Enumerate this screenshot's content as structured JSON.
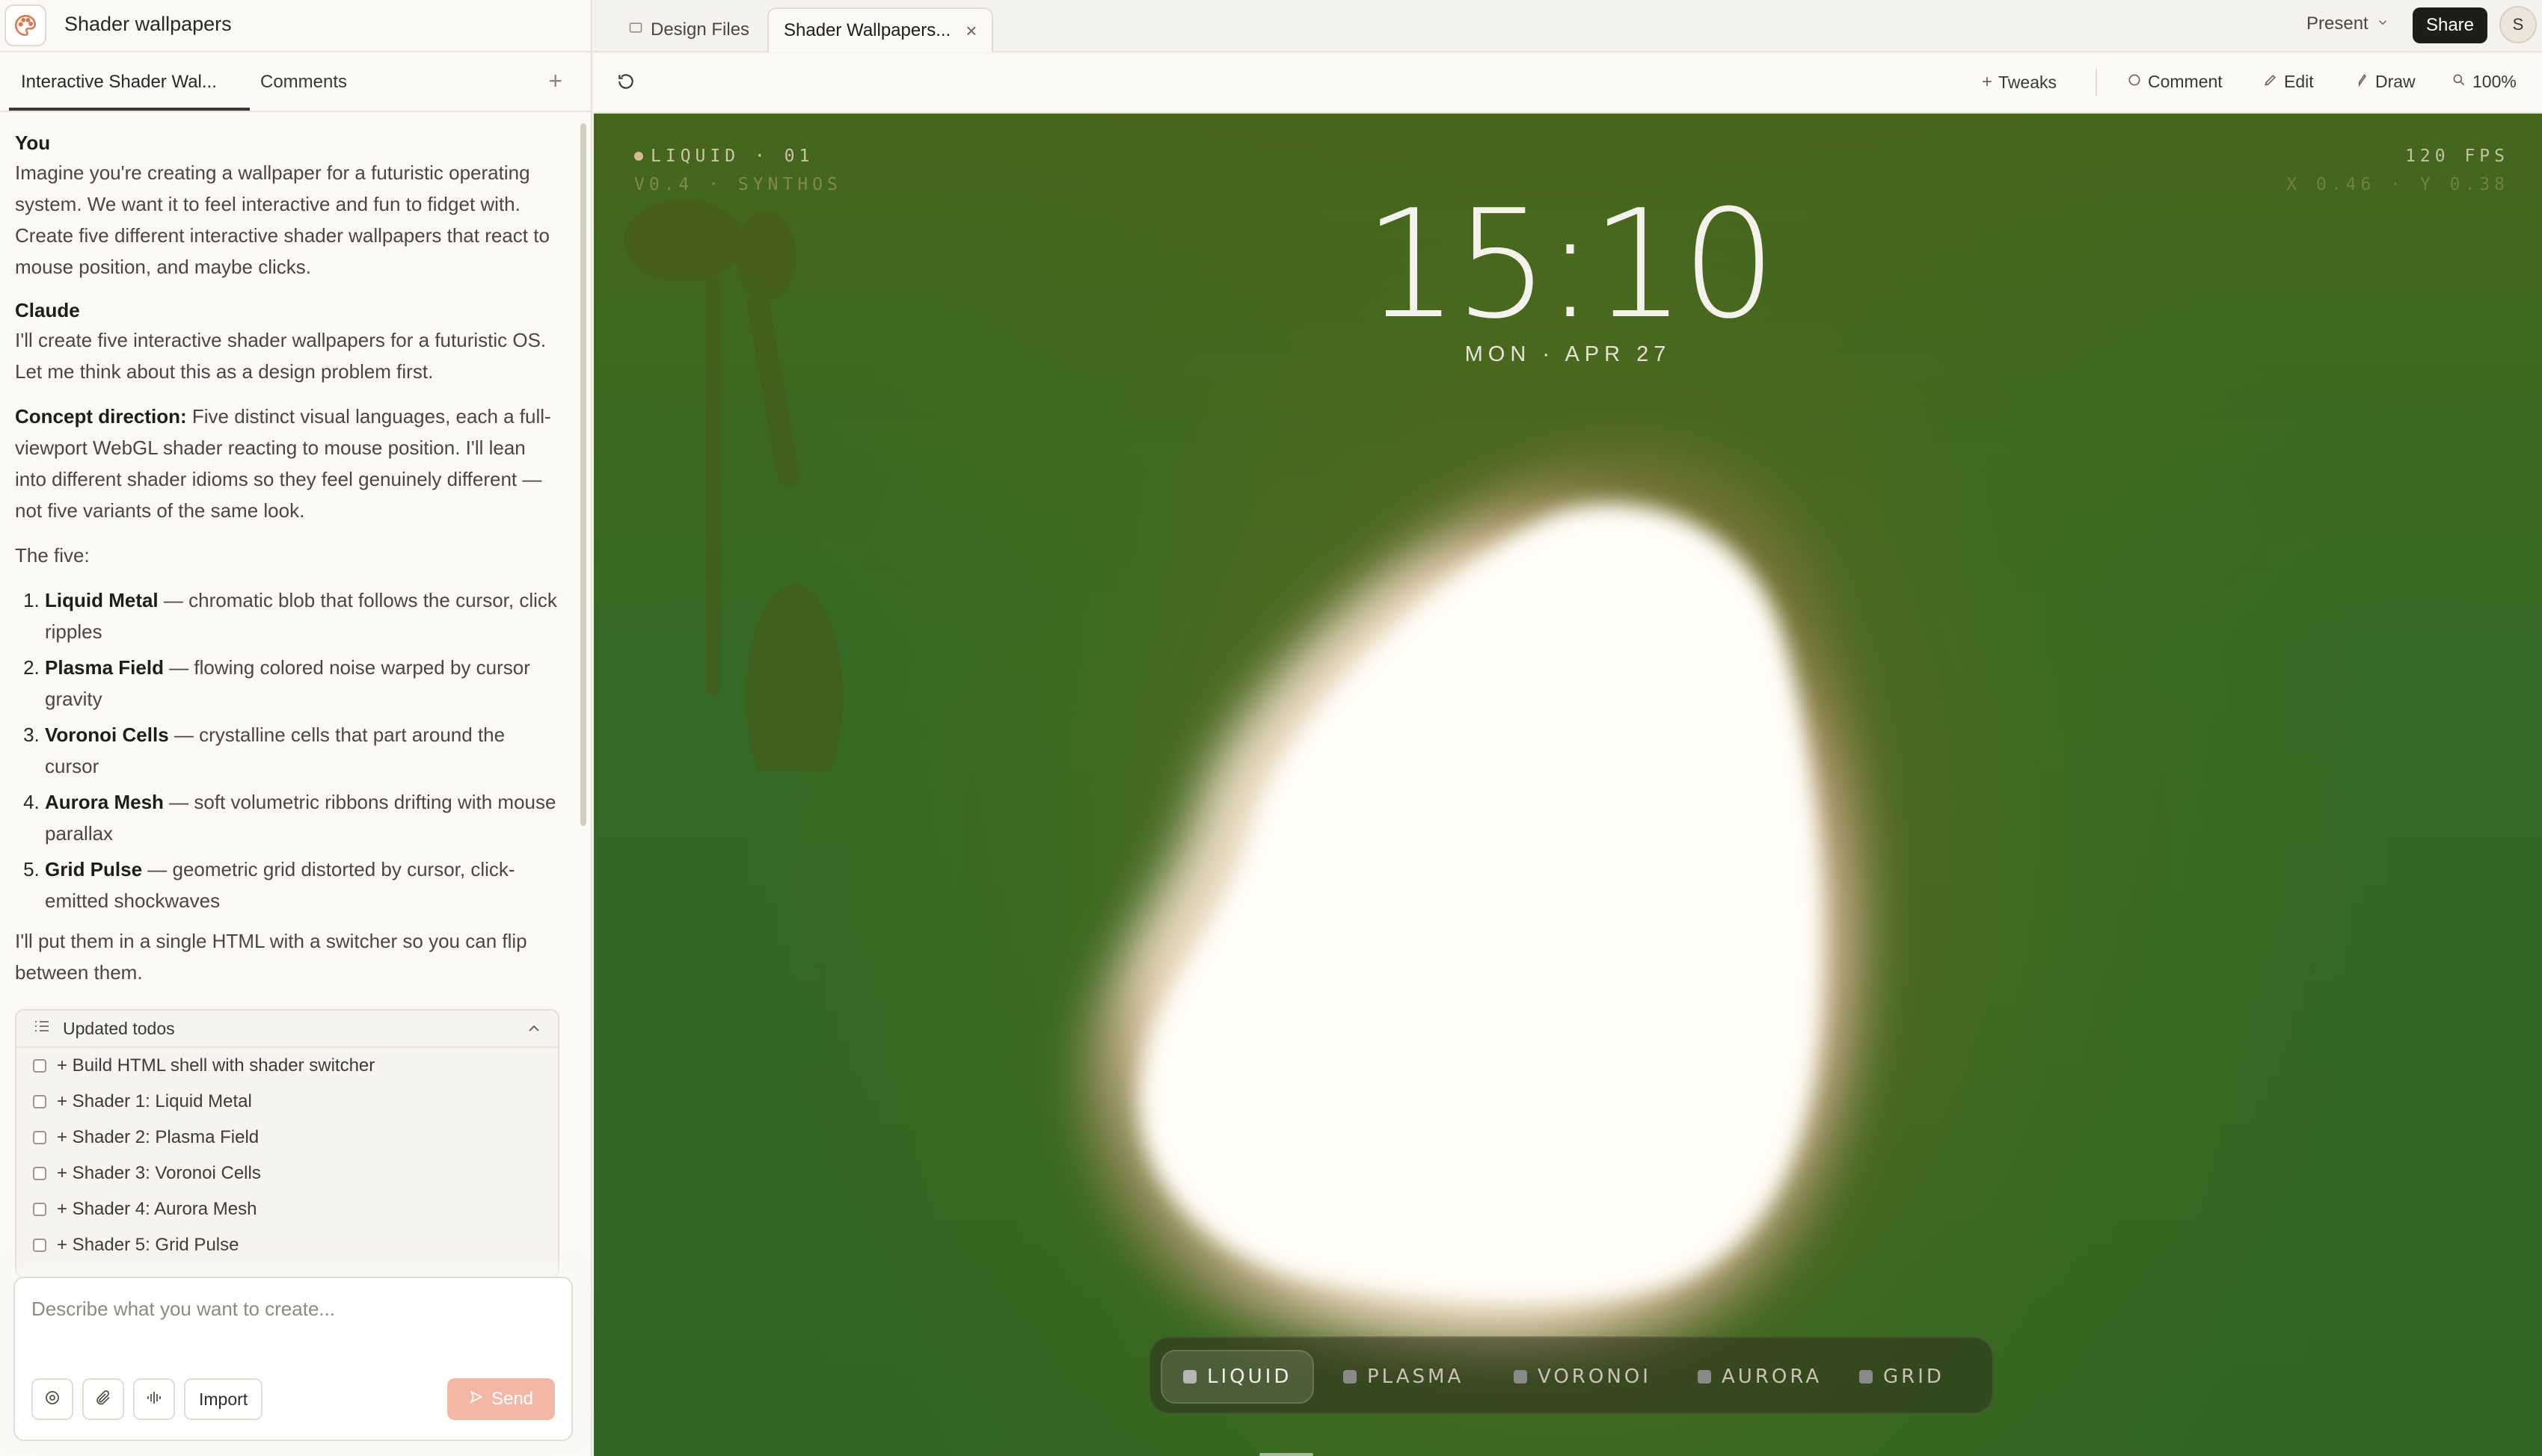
{
  "app": {
    "project_title": "Shader wallpapers"
  },
  "left_tabs": {
    "chat_tab": "Interactive Shader Wal...",
    "comments_tab": "Comments",
    "add": "+"
  },
  "chat": {
    "user_name": "You",
    "user_message": "Imagine you're creating a wallpaper for a futuristic operating system. We want it to feel interactive and fun to fidget with. Create five different interactive shader wallpapers that react to mouse position, and maybe clicks.",
    "assistant_name": "Claude",
    "assistant_intro": "I'll create five interactive shader wallpapers for a futuristic OS. Let me think about this as a design problem first.",
    "concept_label": "Concept direction:",
    "concept_text": " Five distinct visual languages, each a full-viewport WebGL shader reacting to mouse position. I'll lean into different shader idioms so they feel genuinely different — not five variants of the same look.",
    "five_intro": "The five:",
    "items": [
      {
        "name": "Liquid Metal",
        "desc": " — chromatic blob that follows the cursor, click ripples"
      },
      {
        "name": "Plasma Field",
        "desc": " — flowing colored noise warped by cursor gravity"
      },
      {
        "name": "Voronoi Cells",
        "desc": " — crystalline cells that part around the cursor"
      },
      {
        "name": "Aurora Mesh",
        "desc": " — soft volumetric ribbons drifting with mouse parallax"
      },
      {
        "name": "Grid Pulse",
        "desc": " — geometric grid distorted by cursor, click-emitted shockwaves"
      }
    ],
    "closing": "I'll put them in a single HTML with a switcher so you can flip between them."
  },
  "todos": {
    "title": "Updated todos",
    "items": [
      "+ Build HTML shell with shader switcher",
      "+ Shader 1: Liquid Metal",
      "+ Shader 2: Plasma Field",
      "+ Shader 3: Voronoi Cells",
      "+ Shader 4: Aurora Mesh",
      "+ Shader 5: Grid Pulse"
    ]
  },
  "composer": {
    "placeholder": "Describe what you want to create...",
    "import_label": "Import",
    "send_label": "Send"
  },
  "file_tabs": {
    "design_files": "Design Files",
    "active_tab": "Shader Wallpapers...",
    "close": "×"
  },
  "topbar": {
    "present_label": "Present",
    "share_label": "Share",
    "avatar_initial": "S"
  },
  "toolbar": {
    "tweaks": "Tweaks",
    "comment": "Comment",
    "edit": "Edit",
    "draw": "Draw",
    "zoom": "100%"
  },
  "wallpaper": {
    "mode_label": "LIQUID · 01",
    "version_label": "V0.4 · SYNTHOS",
    "fps": "120 FPS",
    "coords": "X 0.46 · Y 0.38",
    "time": "15:10",
    "date": "MON · APR 27",
    "switcher": [
      "LIQUID",
      "PLASMA",
      "VORONOI",
      "AURORA",
      "GRID"
    ],
    "active_index": 0
  },
  "colors": {
    "accent_send": "#f2b8a5",
    "share_bg": "#1f1d1a",
    "wallpaper_green": "#3d6b22",
    "blob_core": "#fffdf6",
    "blob_halo": "#f5b59a"
  }
}
